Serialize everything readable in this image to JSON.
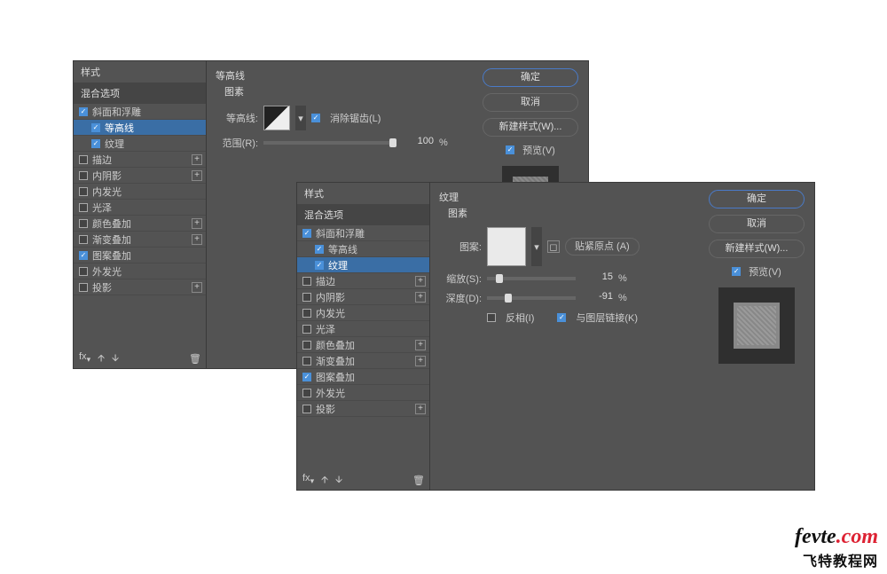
{
  "d1": {
    "styles_header": "样式",
    "blend_header": "混合选项",
    "items": [
      {
        "label": "斜面和浮雕",
        "checked": true,
        "sub": false,
        "sel": false,
        "plus": false
      },
      {
        "label": "等高线",
        "checked": true,
        "sub": true,
        "sel": true,
        "plus": false
      },
      {
        "label": "纹理",
        "checked": true,
        "sub": true,
        "sel": false,
        "plus": false
      },
      {
        "label": "描边",
        "checked": false,
        "sub": false,
        "sel": false,
        "plus": true
      },
      {
        "label": "内阴影",
        "checked": false,
        "sub": false,
        "sel": false,
        "plus": true
      },
      {
        "label": "内发光",
        "checked": false,
        "sub": false,
        "sel": false,
        "plus": false
      },
      {
        "label": "光泽",
        "checked": false,
        "sub": false,
        "sel": false,
        "plus": false
      },
      {
        "label": "颜色叠加",
        "checked": false,
        "sub": false,
        "sel": false,
        "plus": true
      },
      {
        "label": "渐变叠加",
        "checked": false,
        "sub": false,
        "sel": false,
        "plus": true
      },
      {
        "label": "图案叠加",
        "checked": true,
        "sub": false,
        "sel": false,
        "plus": false
      },
      {
        "label": "外发光",
        "checked": false,
        "sub": false,
        "sel": false,
        "plus": false
      },
      {
        "label": "投影",
        "checked": false,
        "sub": false,
        "sel": false,
        "plus": true
      }
    ],
    "mid": {
      "title": "等高线",
      "subtitle": "图素",
      "contour_label": "等高线:",
      "antialias_label": "消除锯齿(L)",
      "range_label": "范围(R):",
      "range_value": "100",
      "pct": "%"
    },
    "rp": {
      "ok": "确定",
      "cancel": "取消",
      "newstyle": "新建样式(W)...",
      "preview": "预览(V)"
    }
  },
  "d2": {
    "styles_header": "样式",
    "blend_header": "混合选项",
    "items": [
      {
        "label": "斜面和浮雕",
        "checked": true,
        "sub": false,
        "sel": false,
        "plus": false
      },
      {
        "label": "等高线",
        "checked": true,
        "sub": true,
        "sel": false,
        "plus": false
      },
      {
        "label": "纹理",
        "checked": true,
        "sub": true,
        "sel": true,
        "plus": false
      },
      {
        "label": "描边",
        "checked": false,
        "sub": false,
        "sel": false,
        "plus": true
      },
      {
        "label": "内阴影",
        "checked": false,
        "sub": false,
        "sel": false,
        "plus": true
      },
      {
        "label": "内发光",
        "checked": false,
        "sub": false,
        "sel": false,
        "plus": false
      },
      {
        "label": "光泽",
        "checked": false,
        "sub": false,
        "sel": false,
        "plus": false
      },
      {
        "label": "颜色叠加",
        "checked": false,
        "sub": false,
        "sel": false,
        "plus": true
      },
      {
        "label": "渐变叠加",
        "checked": false,
        "sub": false,
        "sel": false,
        "plus": true
      },
      {
        "label": "图案叠加",
        "checked": true,
        "sub": false,
        "sel": false,
        "plus": false
      },
      {
        "label": "外发光",
        "checked": false,
        "sub": false,
        "sel": false,
        "plus": false
      },
      {
        "label": "投影",
        "checked": false,
        "sub": false,
        "sel": false,
        "plus": true
      }
    ],
    "mid": {
      "title": "纹理",
      "subtitle": "图素",
      "pattern_label": "图案:",
      "snap_label": "贴紧原点 (A)",
      "scale_label": "缩放(S):",
      "scale_value": "15",
      "depth_label": "深度(D):",
      "depth_value": "-91",
      "pct": "%",
      "invert_label": "反相(I)",
      "link_label": "与图层链接(K)"
    },
    "rp": {
      "ok": "确定",
      "cancel": "取消",
      "newstyle": "新建样式(W)...",
      "preview": "预览(V)"
    }
  },
  "logo": {
    "line1a": "fevte",
    "line1b": ".com",
    "line2": "飞特教程网"
  }
}
